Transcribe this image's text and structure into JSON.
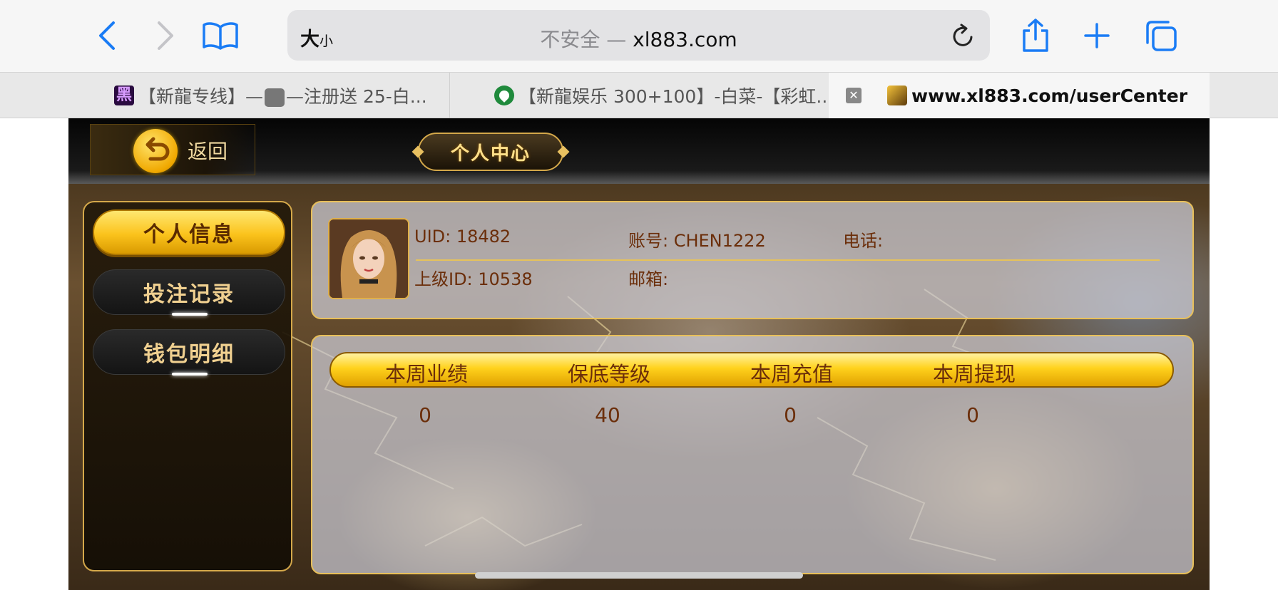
{
  "browser": {
    "text_size_label": "大",
    "text_size_small": "小",
    "insecure_label": "不安全 —",
    "domain": "xl883.com"
  },
  "tabs": [
    {
      "favicon_text": "黑",
      "title_prefix": "【新龍专线】—",
      "title_suffix": "—注册送 25-白..."
    },
    {
      "title": "【新龍娱乐 300+100】-白菜-【彩虹..."
    },
    {
      "title": "www.xl883.com/userCenter",
      "close": "✕"
    }
  ],
  "game": {
    "back_label": "返回",
    "page_title": "个人中心",
    "sidebar": [
      {
        "label": "个人信息",
        "active": true
      },
      {
        "label": "投注记录",
        "active": false
      },
      {
        "label": "钱包明细",
        "active": false
      }
    ],
    "profile": {
      "uid": "UID: 18482",
      "account": "账号: CHEN1222",
      "phone": "电话:",
      "parent_id": "上级ID: 10538",
      "email": "邮箱:"
    },
    "stats": {
      "headers": [
        "本周业绩",
        "保底等级",
        "本周充值",
        "本周提现"
      ],
      "values": [
        "0",
        "40",
        "0",
        "0"
      ]
    }
  },
  "colors": {
    "accent_gold": "#fbc31c",
    "text_brown": "#6b2e0a",
    "ios_blue": "#1a7cf5"
  }
}
